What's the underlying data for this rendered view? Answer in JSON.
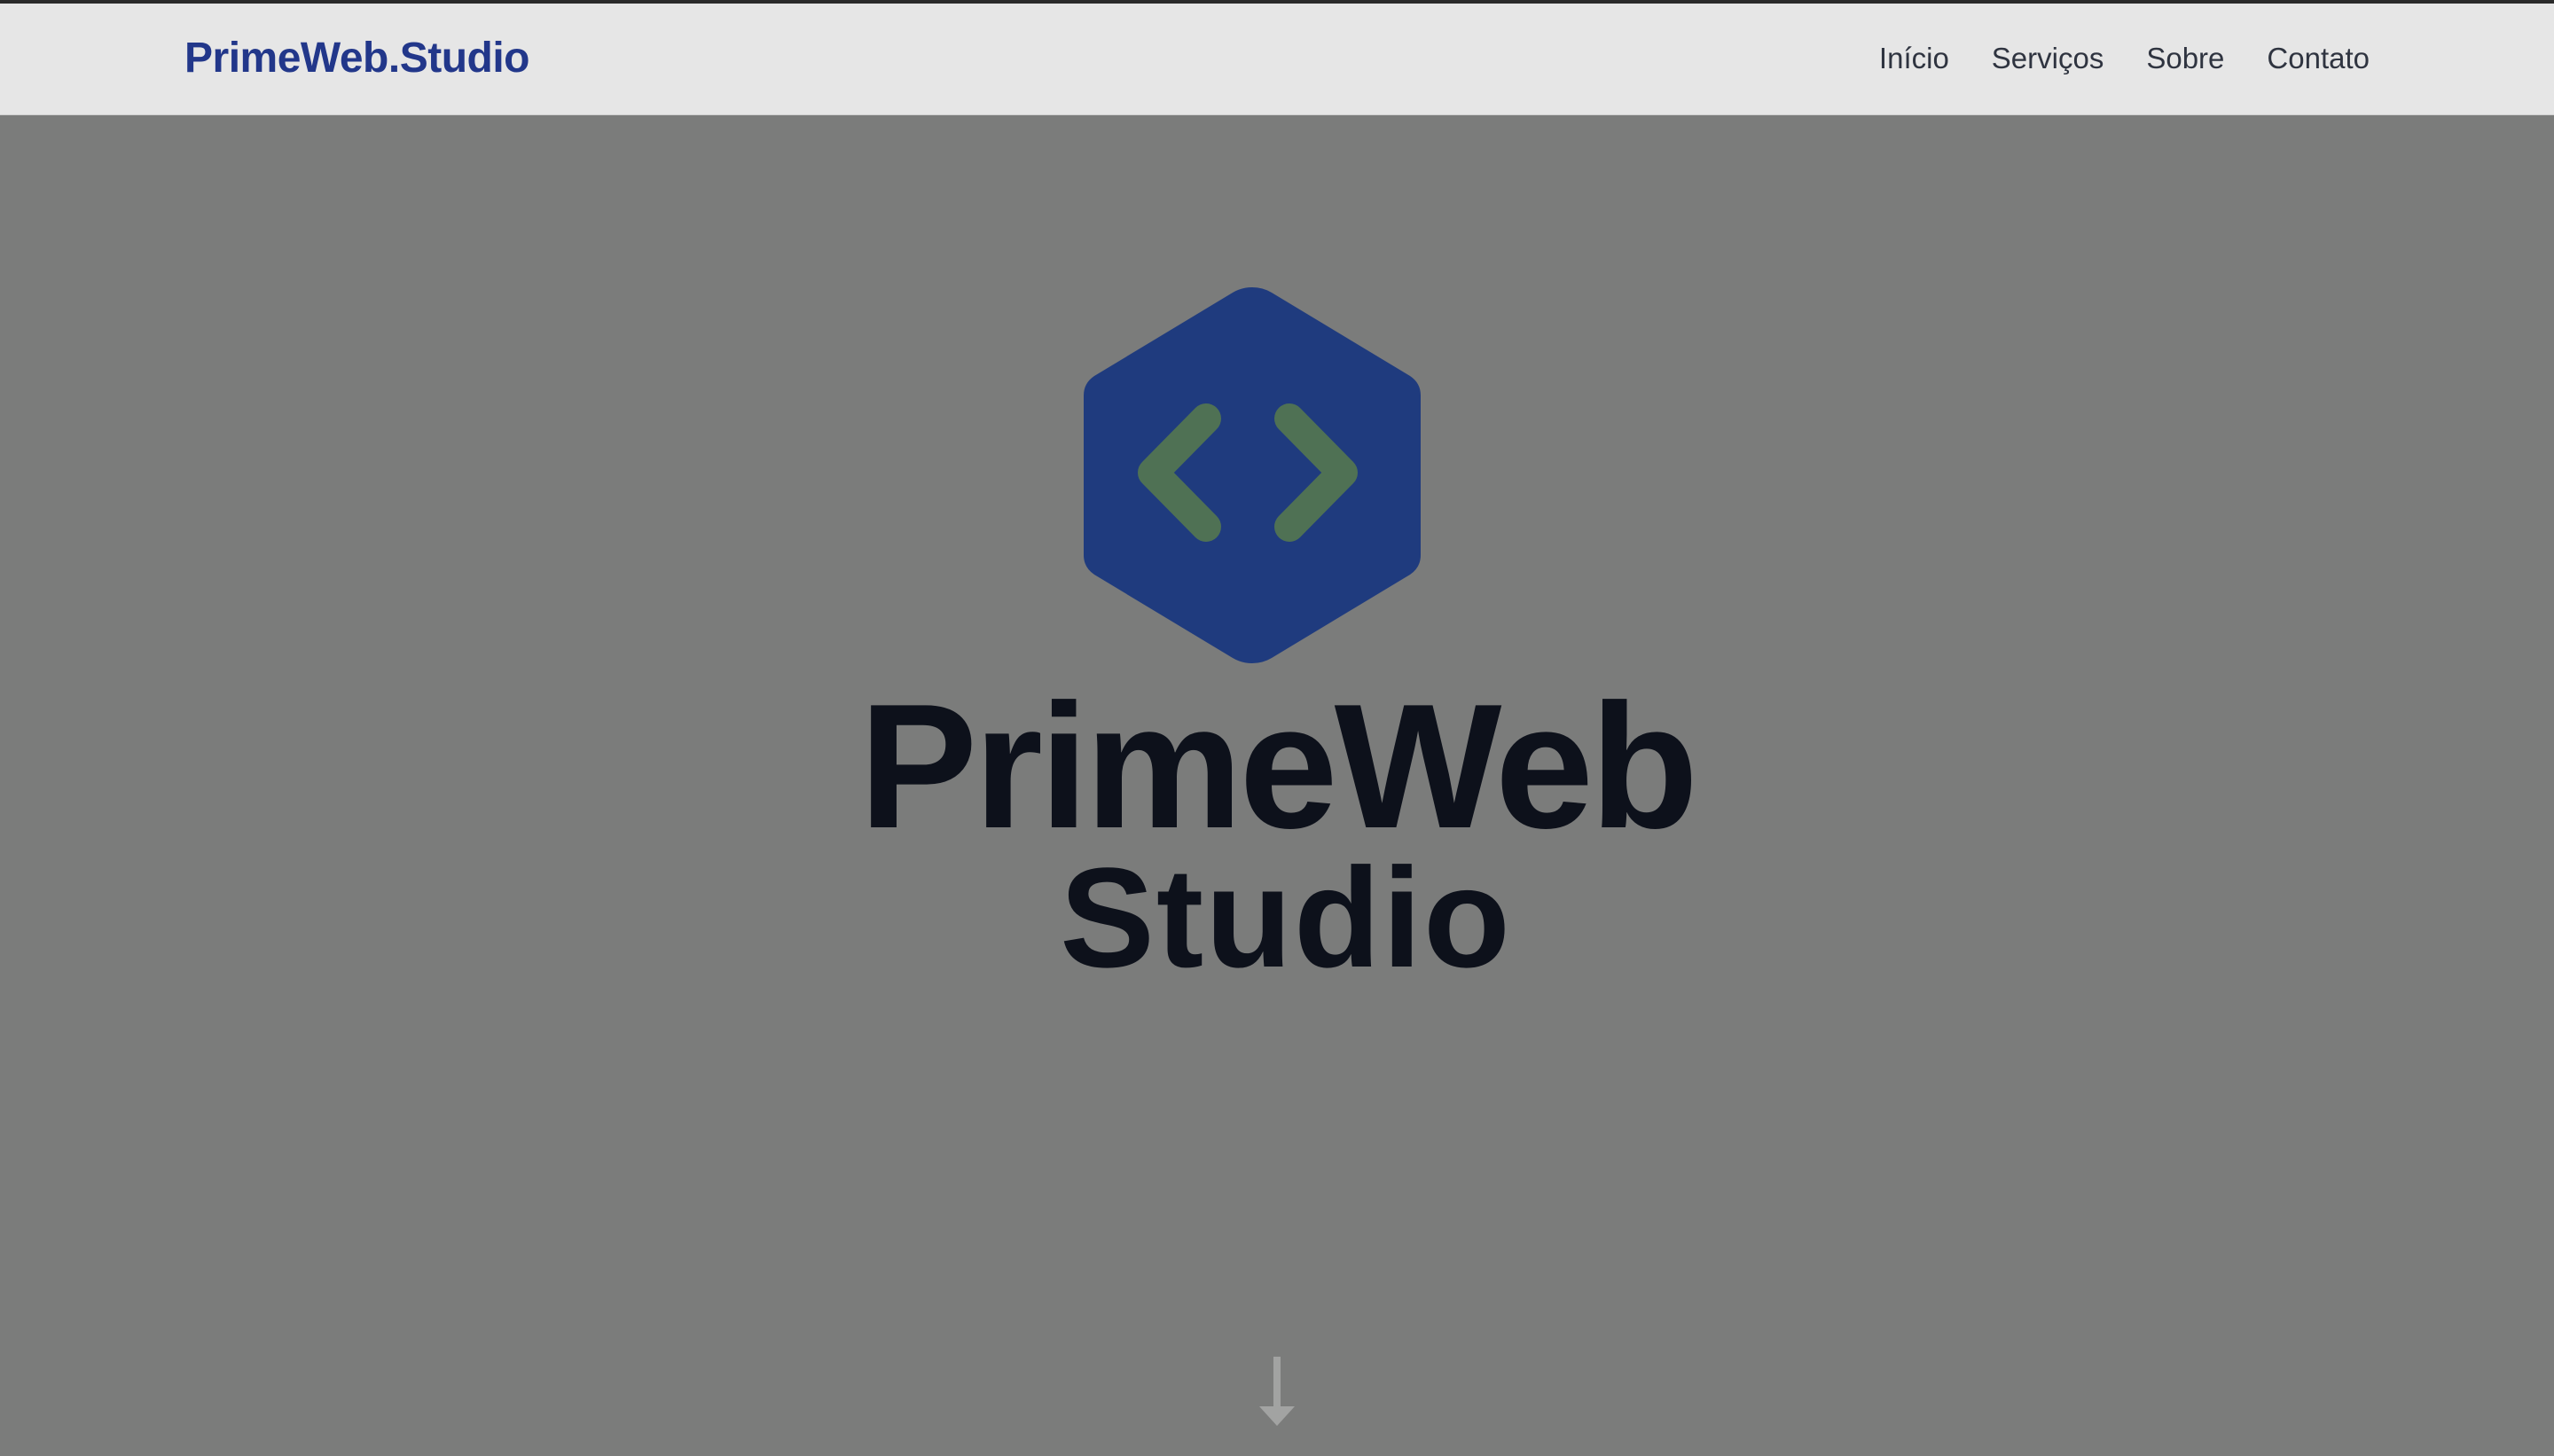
{
  "nav": {
    "brand": "PrimeWeb.Studio",
    "links": [
      "Início",
      "Serviços",
      "Sobre",
      "Contato"
    ]
  },
  "hero": {
    "logo_line1": "PrimeWeb",
    "logo_line2": "Studio",
    "logo_icon": "code-brackets-hexagon-icon",
    "scroll_icon": "arrow-down-icon"
  },
  "colors": {
    "brand_blue": "#22378a",
    "hex_blue": "#1f3b7e",
    "bracket_green": "#4f7154",
    "overlay_gray": "#7b7c7b",
    "nav_bg": "#e6e6e6"
  }
}
